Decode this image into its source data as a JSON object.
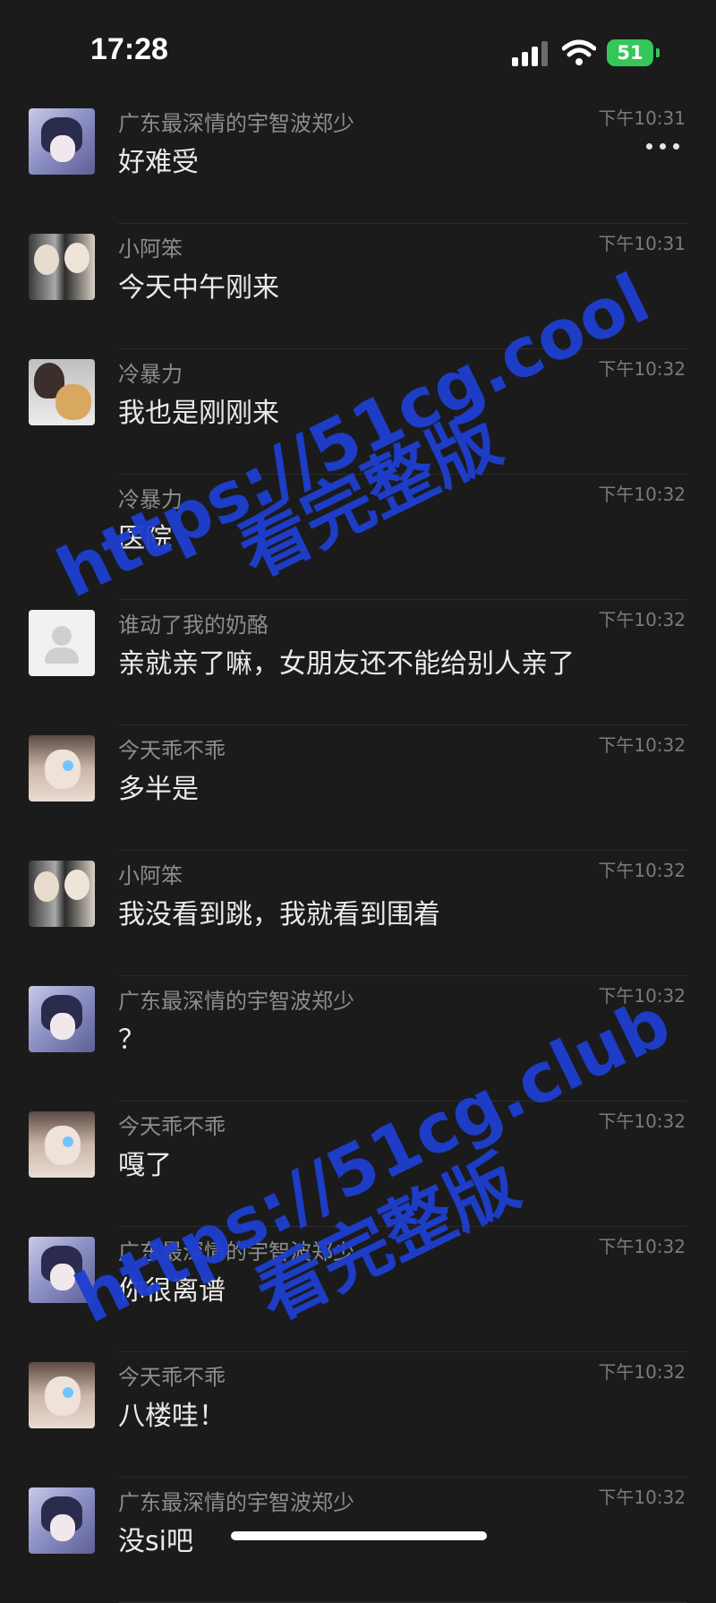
{
  "status_bar": {
    "time": "17:28",
    "battery": "51"
  },
  "messages": [
    {
      "name": "广东最深情的宇智波郑少",
      "time": "下午10:31",
      "text": "好难受",
      "avatar": "anime"
    },
    {
      "name": "小阿笨",
      "time": "下午10:31",
      "text": "今天中午刚来",
      "avatar": "couple"
    },
    {
      "name": "冷暴力",
      "time": "下午10:32",
      "text": "我也是刚刚来",
      "avatar": "dog"
    },
    {
      "name": "冷暴力",
      "time": "下午10:32",
      "text": "医院",
      "avatar": "none"
    },
    {
      "name": "谁动了我的奶酪",
      "time": "下午10:32",
      "text": "亲就亲了嘛，女朋友还不能给别人亲了",
      "avatar": "default"
    },
    {
      "name": "今天乖不乖",
      "time": "下午10:32",
      "text": "多半是",
      "avatar": "girl"
    },
    {
      "name": "小阿笨",
      "time": "下午10:32",
      "text": "我没看到跳，我就看到围着",
      "avatar": "couple"
    },
    {
      "name": "广东最深情的宇智波郑少",
      "time": "下午10:32",
      "text": "？",
      "avatar": "anime"
    },
    {
      "name": "今天乖不乖",
      "time": "下午10:32",
      "text": "嘎了",
      "avatar": "girl"
    },
    {
      "name": "广东最深情的宇智波郑少",
      "time": "下午10:32",
      "text": "你很离谱",
      "avatar": "anime"
    },
    {
      "name": "今天乖不乖",
      "time": "下午10:32",
      "text": "八楼哇！",
      "avatar": "girl"
    },
    {
      "name": "广东最深情的宇智波郑少",
      "time": "下午10:32",
      "text": "没si吧",
      "avatar": "anime"
    }
  ],
  "watermarks": [
    {
      "url": "https://51cg.cool",
      "caption": "看完整版"
    },
    {
      "url": "https://51cg.club",
      "caption": "看完整版"
    }
  ],
  "icons": {
    "back": "back-icon",
    "more": "more-icon"
  },
  "colors": {
    "background": "#1b1b1b",
    "battery": "#35c759",
    "watermark": "#1e3fd0"
  }
}
